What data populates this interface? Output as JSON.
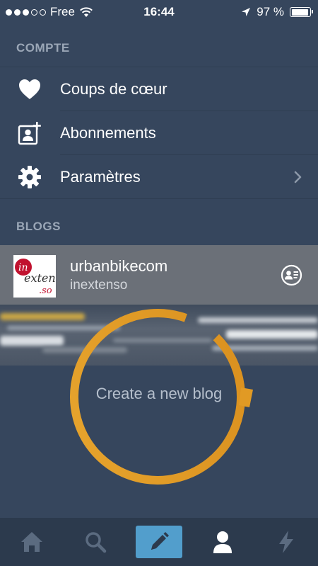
{
  "status_bar": {
    "carrier": "Free",
    "time": "16:44",
    "battery": "97 %",
    "battery_level": 0.97
  },
  "account": {
    "section_label": "COMPTE",
    "items": [
      {
        "label": "Coups de cœur",
        "icon": "heart-icon"
      },
      {
        "label": "Abonnements",
        "icon": "person-add-icon"
      },
      {
        "label": "Paramètres",
        "icon": "gear-icon"
      }
    ]
  },
  "blogs": {
    "section_label": "BLOGS",
    "current": {
      "name": "urbanbikecom",
      "subtitle": "inextenso",
      "avatar_logo_text": "in exten .so"
    },
    "create_label": "Create a new blog"
  },
  "tabbar": {
    "tabs": [
      "home-icon",
      "search-icon",
      "compose-icon",
      "account-icon",
      "activity-icon"
    ],
    "active": "account-icon",
    "accent": "#529ecc"
  },
  "colors": {
    "background": "#36465d",
    "ring": "#e39a27",
    "blog_row": "#6b7078"
  }
}
